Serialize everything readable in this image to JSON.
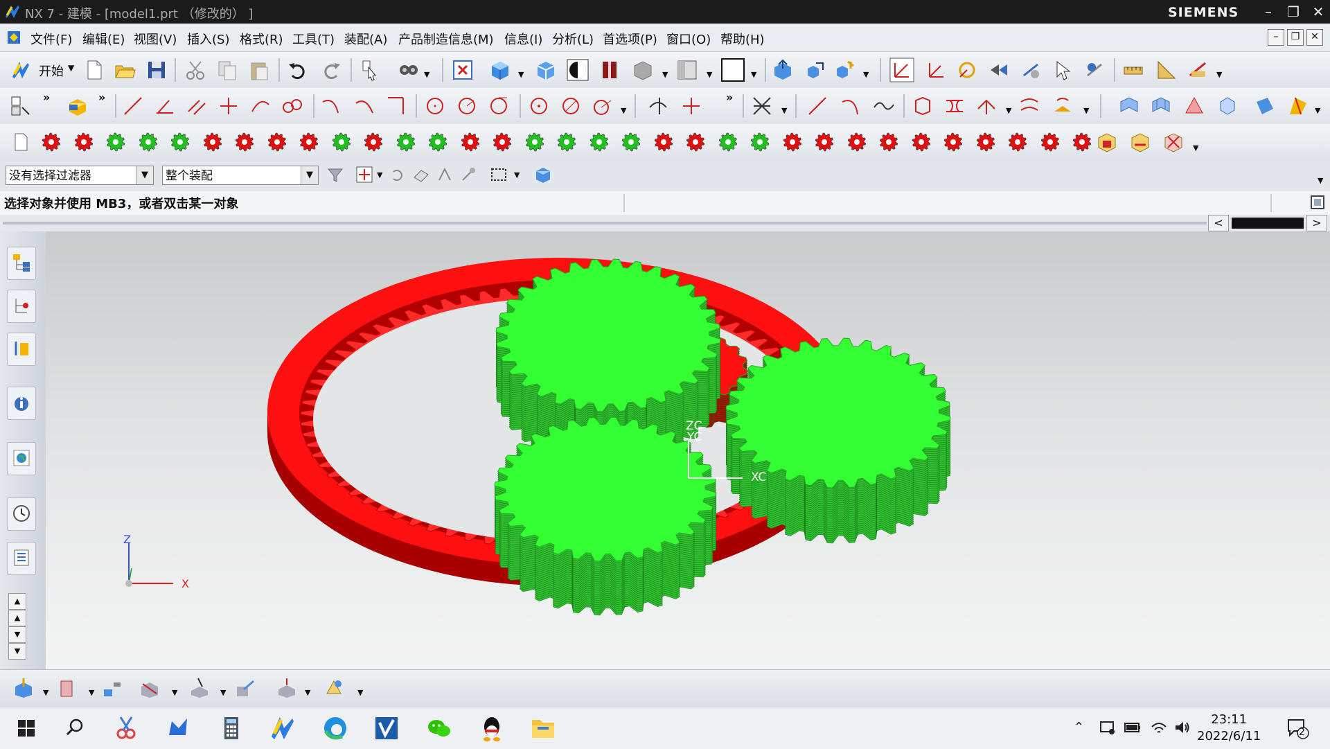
{
  "window": {
    "title": "NX 7 - 建模 - [model1.prt （修改的） ]",
    "brand": "SIEMENS"
  },
  "menu": [
    "文件(F)",
    "编辑(E)",
    "视图(V)",
    "插入(S)",
    "格式(R)",
    "工具(T)",
    "装配(A)",
    "产品制造信息(M)",
    "信息(I)",
    "分析(L)",
    "首选项(P)",
    "窗口(O)",
    "帮助(H)"
  ],
  "toolbar": {
    "start_label": "开始"
  },
  "filters": {
    "selection_filter": "没有选择过滤器",
    "assembly_scope": "整个装配"
  },
  "status": {
    "message": "选择对象并使用 MB3，或者双击某一对象"
  },
  "viewport": {
    "wcs": {
      "z": "ZC",
      "y": "YC",
      "x": "XC"
    },
    "triad": {
      "z": "Z",
      "x": "X"
    }
  },
  "colors": {
    "ring_gear": "#ff1010",
    "planet_gear": "#33ff33",
    "sun_gear": "#ff1010",
    "background_top": "#c9cbcc"
  },
  "taskbar": {
    "icons": [
      "start-icon",
      "search-icon",
      "snipping-icon",
      "bluetooth-icon",
      "calculator-icon",
      "nx-icon",
      "edge-icon",
      "vmware-icon",
      "wechat-icon",
      "qq-icon",
      "explorer-icon"
    ],
    "time": "23:11",
    "date": "2022/6/11",
    "notifications": "2"
  }
}
